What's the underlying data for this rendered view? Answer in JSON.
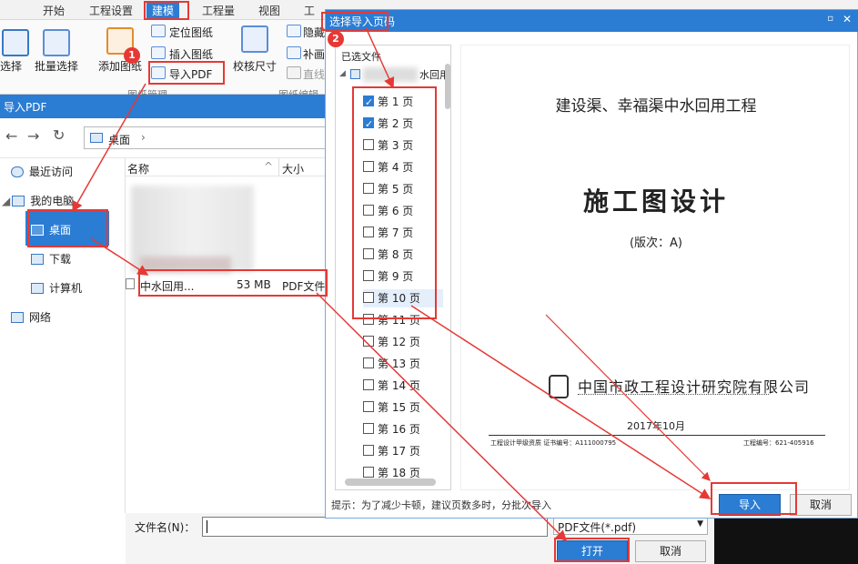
{
  "ribbon": {
    "tabs": [
      "开始",
      "工程设置",
      "建模",
      "工程量",
      "视图",
      "工"
    ],
    "buttons": {
      "select": "选择",
      "batch_select": "批量选择",
      "add_drawing": "添加图纸",
      "locate_drawing": "定位图纸",
      "insert_drawing": "插入图纸",
      "import_pdf": "导入PDF",
      "verify_size": "校核尺寸",
      "hide": "隐藏",
      "patch": "补画",
      "line": "直线"
    },
    "groups": {
      "drawing_mgmt": "图纸管理",
      "drawing_edit": "图纸编辑"
    }
  },
  "file_dialog": {
    "title": "导入PDF",
    "address": "桌面",
    "sidebar": [
      "最近访问",
      "我的电脑",
      "桌面",
      "下载",
      "计算机",
      "网络"
    ],
    "columns": {
      "name": "名称",
      "size": "大小"
    },
    "file": {
      "name": "中水回用...",
      "size": "53 MB",
      "type": "PDF文件"
    },
    "filename_label": "文件名(N)：",
    "filename_value": "",
    "filter": "PDF文件(*.pdf)",
    "open": "打开",
    "cancel": "取消"
  },
  "page_dialog": {
    "title": "选择导入页码",
    "selected_files_label": "已选文件",
    "file_label": "水回用",
    "pages": [
      {
        "label": "第 1 页",
        "checked": true
      },
      {
        "label": "第 2 页",
        "checked": true
      },
      {
        "label": "第 3 页",
        "checked": false
      },
      {
        "label": "第 4 页",
        "checked": false
      },
      {
        "label": "第 5 页",
        "checked": false
      },
      {
        "label": "第 6 页",
        "checked": false
      },
      {
        "label": "第 7 页",
        "checked": false
      },
      {
        "label": "第 8 页",
        "checked": false
      },
      {
        "label": "第 9 页",
        "checked": false
      },
      {
        "label": "第 10 页",
        "checked": false
      },
      {
        "label": "第 11 页",
        "checked": false
      },
      {
        "label": "第 12 页",
        "checked": false
      },
      {
        "label": "第 13 页",
        "checked": false
      },
      {
        "label": "第 14 页",
        "checked": false
      },
      {
        "label": "第 15 页",
        "checked": false
      },
      {
        "label": "第 16 页",
        "checked": false
      },
      {
        "label": "第 17 页",
        "checked": false
      },
      {
        "label": "第 18 页",
        "checked": false
      }
    ],
    "preview": {
      "project": "建设渠、幸福渠中水回用工程",
      "heading": "施工图设计",
      "version": "(版次：A)",
      "company": "中国市政工程设计研究院有限公司",
      "date": "2017年10月",
      "cert_left": "工程设计甲级资质  证书编号：A111000795",
      "cert_right": "工程编号：621-405916"
    },
    "hint": "提示：为了减少卡顿，建议页数多时，分批次导入",
    "import": "导入",
    "cancel": "取消"
  },
  "annotations": {
    "badge1": "1",
    "badge2": "2",
    "color": "#e53935"
  }
}
